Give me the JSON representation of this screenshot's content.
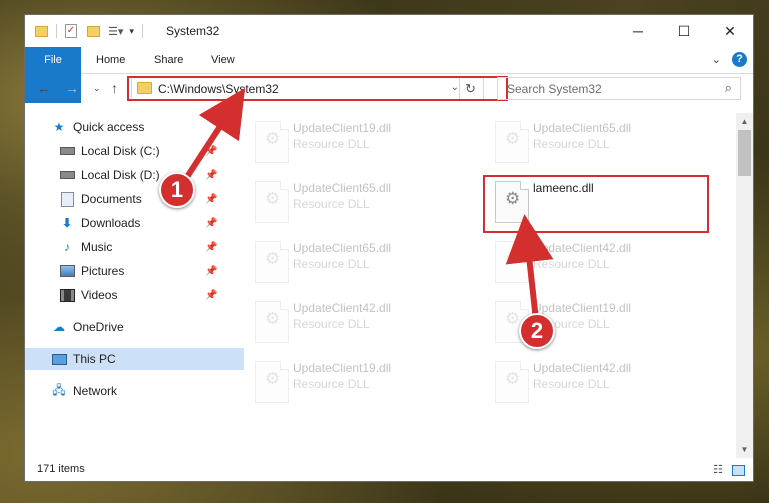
{
  "window": {
    "title": "System32"
  },
  "ribbon": {
    "tabs": [
      "File",
      "Home",
      "Share",
      "View"
    ],
    "help_label": "?"
  },
  "address": {
    "path": "C:\\Windows\\System32"
  },
  "search": {
    "placeholder": "Search System32"
  },
  "sidebar": {
    "items": [
      {
        "label": "Quick access",
        "icon": "star-icon"
      },
      {
        "label": "Local Disk (C:)",
        "icon": "drive-icon"
      },
      {
        "label": "Local Disk (D:)",
        "icon": "drive-icon"
      },
      {
        "label": "Documents",
        "icon": "documents-icon"
      },
      {
        "label": "Downloads",
        "icon": "download-arrow-icon"
      },
      {
        "label": "Music",
        "icon": "music-note-icon"
      },
      {
        "label": "Pictures",
        "icon": "pictures-icon"
      },
      {
        "label": "Videos",
        "icon": "film-icon"
      },
      {
        "label": "OneDrive",
        "icon": "cloud-icon"
      },
      {
        "label": "This PC",
        "icon": "computer-icon"
      },
      {
        "label": "Network",
        "icon": "network-icon"
      }
    ]
  },
  "files": [
    {
      "name": "UpdateClient19.dll",
      "type": "Resource DLL"
    },
    {
      "name": "UpdateClient65.dll",
      "type": "Resource DLL"
    },
    {
      "name": "UpdateClient65.dll",
      "type": "Resource DLL"
    },
    {
      "name": "lameenc.dll",
      "type": ""
    },
    {
      "name": "UpdateClient65.dll",
      "type": "Resource DLL"
    },
    {
      "name": "UpdateClient42.dll",
      "type": "Resource DLL"
    },
    {
      "name": "UpdateClient42.dll",
      "type": "Resource DLL"
    },
    {
      "name": "UpdateClient19.dll",
      "type": "Resource DLL"
    },
    {
      "name": "UpdateClient19.dll",
      "type": "Resource DLL"
    },
    {
      "name": "UpdateClient42.dll",
      "type": "Resource DLL"
    }
  ],
  "status": {
    "item_count": "171 items"
  },
  "callouts": {
    "one": "1",
    "two": "2"
  },
  "colors": {
    "accent": "#1979ca",
    "highlight": "#d32f2f",
    "selected": "#cce1f7"
  }
}
